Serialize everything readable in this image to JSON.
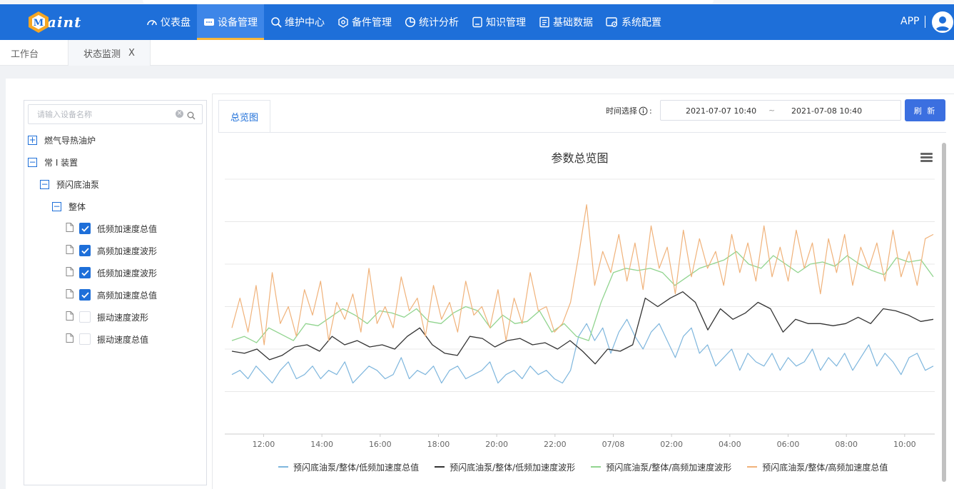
{
  "header": {
    "logo_text": "aint",
    "nav": [
      {
        "label": "仪表盘",
        "icon": "dashboard-icon",
        "active": false
      },
      {
        "label": "设备管理",
        "icon": "device-icon",
        "active": true
      },
      {
        "label": "维护中心",
        "icon": "maintenance-icon",
        "active": false
      },
      {
        "label": "备件管理",
        "icon": "spare-parts-icon",
        "active": false
      },
      {
        "label": "统计分析",
        "icon": "pie-chart-icon",
        "active": false
      },
      {
        "label": "知识管理",
        "icon": "knowledge-icon",
        "active": false
      },
      {
        "label": "基础数据",
        "icon": "base-data-icon",
        "active": false
      },
      {
        "label": "系统配置",
        "icon": "settings-icon",
        "active": false
      }
    ],
    "app_label": "APP",
    "colors": {
      "bar": "#1e6fd9",
      "active_underline": "#f5b63a"
    }
  },
  "tabs": [
    {
      "label": "工作台"
    },
    {
      "label": "状态监测",
      "close": "X"
    }
  ],
  "tree": {
    "search_placeholder": "请输入设备名称",
    "nodes": [
      {
        "label": "燃气导热油炉",
        "toggle": "+",
        "level": 0
      },
      {
        "label": "常 I 装置",
        "toggle": "−",
        "level": 0
      },
      {
        "label": "预闪底油泵",
        "toggle": "−",
        "level": 1
      },
      {
        "label": "整体",
        "toggle": "−",
        "level": 2
      }
    ],
    "leaves": [
      {
        "label": "低频加速度总值",
        "checked": true
      },
      {
        "label": "高频加速度波形",
        "checked": true
      },
      {
        "label": "低频加速度波形",
        "checked": true
      },
      {
        "label": "高频加速度总值",
        "checked": true
      },
      {
        "label": "振动速度波形",
        "checked": false
      },
      {
        "label": "振动速度总值",
        "checked": false
      }
    ]
  },
  "panel": {
    "tab_label": "总览图",
    "time_label": "时间选择",
    "time_colon": ":",
    "start": "2021-07-07 10:40",
    "range_sep": "~",
    "end": "2021-07-08 10:40",
    "refresh_label": "刷 新"
  },
  "chart_data": {
    "type": "line",
    "title": "参数总览图",
    "x_ticks": [
      "12:00",
      "14:00",
      "16:00",
      "18:00",
      "20:00",
      "22:00",
      "07/08",
      "02:00",
      "04:00",
      "06:00",
      "08:00",
      "10:00"
    ],
    "x_start": "2021-07-07 10:40",
    "x_end": "2021-07-08 10:40",
    "y_axis_labels": "hidden",
    "ylim": [
      0,
      6
    ],
    "grid": true,
    "legend_position": "bottom",
    "series": [
      {
        "name": "预闪底油泵/整体/低频加速度总值",
        "color": "#7eb6dd",
        "style": "noisy",
        "values": [
          1.4,
          1.5,
          1.3,
          1.6,
          1.4,
          1.2,
          1.5,
          1.7,
          1.3,
          1.4,
          1.6,
          1.3,
          1.5,
          1.4,
          1.7,
          1.2,
          1.4,
          1.6,
          1.5,
          1.3,
          1.4,
          1.8,
          1.3,
          1.5,
          1.4,
          1.6,
          1.2,
          1.5,
          1.6,
          1.3,
          1.4,
          1.5,
          1.7,
          1.2,
          1.4,
          1.5,
          1.3,
          1.6,
          1.4,
          1.5,
          1.3,
          1.2,
          1.5,
          2.3,
          2.6,
          2.2,
          2.5,
          1.9,
          2.4,
          2.7,
          2.3,
          2.0,
          2.4,
          2.6,
          2.2,
          1.8,
          2.3,
          2.5,
          1.9,
          2.1,
          1.6,
          1.8,
          2.0,
          1.5,
          1.9,
          1.7,
          1.6,
          1.9,
          1.5,
          1.8,
          1.6,
          1.7,
          2.0,
          1.5,
          1.8,
          1.6,
          1.9,
          1.5,
          1.8,
          2.1,
          1.6,
          1.9,
          1.7,
          1.4,
          1.8,
          1.9,
          1.5,
          1.6
        ]
      },
      {
        "name": "预闪底油泵/整体/低频加速度波形",
        "color": "#333333",
        "style": "smooth",
        "values": [
          1.95,
          1.9,
          2.0,
          1.75,
          1.85,
          2.05,
          2.1,
          1.95,
          2.3,
          2.1,
          2.2,
          2.05,
          2.1,
          2.0,
          2.3,
          2.5,
          2.1,
          1.9,
          1.85,
          2.3,
          2.25,
          2.05,
          2.2,
          2.25,
          2.1,
          2.15,
          2.0,
          2.2,
          1.95,
          1.65,
          2.0,
          1.95,
          2.1,
          3.2,
          3.0,
          3.2,
          3.35,
          3.1,
          2.45,
          2.95,
          2.7,
          2.85,
          3.1,
          2.95,
          2.4,
          2.7,
          2.6,
          2.6,
          2.55,
          2.6,
          2.75,
          2.6,
          2.95,
          2.9,
          2.8,
          2.65,
          2.7
        ]
      },
      {
        "name": "预闪底油泵/整体/高频加速度波形",
        "color": "#91d48f",
        "style": "smooth",
        "values": [
          2.2,
          2.3,
          2.15,
          2.5,
          2.35,
          2.2,
          2.6,
          2.55,
          2.75,
          2.95,
          2.8,
          2.6,
          2.9,
          2.85,
          2.75,
          2.95,
          2.65,
          2.6,
          2.85,
          3.0,
          2.9,
          2.5,
          2.8,
          2.6,
          2.65,
          2.9,
          2.4,
          2.6,
          2.3,
          2.2,
          3.1,
          3.8,
          3.9,
          3.85,
          3.9,
          3.8,
          3.5,
          3.7,
          3.9,
          4.0,
          4.1,
          4.3,
          4.0,
          3.9,
          4.2,
          4.0,
          3.8,
          4.0,
          4.05,
          3.95,
          4.2,
          4.0,
          3.85,
          3.75,
          4.15,
          4.05,
          4.1,
          3.7
        ]
      },
      {
        "name": "预闪底油泵/整体/高频加速度总值",
        "color": "#f0b27a",
        "style": "noisy",
        "values": [
          2.5,
          3.2,
          2.4,
          3.5,
          2.1,
          3.8,
          2.6,
          3.0,
          2.3,
          3.4,
          2.8,
          3.6,
          2.2,
          3.1,
          2.7,
          3.3,
          2.4,
          3.9,
          2.6,
          3.0,
          2.5,
          3.7,
          2.9,
          3.2,
          2.3,
          3.5,
          2.7,
          3.1,
          2.4,
          3.6,
          2.8,
          3.0,
          2.5,
          3.4,
          2.2,
          3.2,
          2.6,
          3.8,
          2.9,
          3.0,
          2.4,
          2.6,
          3.1,
          4.2,
          5.4,
          3.5,
          4.3,
          3.8,
          4.7,
          3.6,
          4.5,
          3.4,
          4.9,
          3.9,
          4.4,
          3.3,
          4.8,
          3.7,
          4.6,
          3.9,
          4.3,
          3.5,
          4.7,
          3.8,
          4.5,
          3.6,
          4.9,
          3.7,
          4.4,
          3.6,
          4.8,
          3.9,
          4.5,
          3.3,
          4.6,
          3.8,
          4.7,
          3.5,
          4.4,
          3.9,
          4.5,
          3.6,
          4.8,
          3.7,
          4.3,
          3.5,
          4.6,
          4.7
        ]
      }
    ]
  }
}
